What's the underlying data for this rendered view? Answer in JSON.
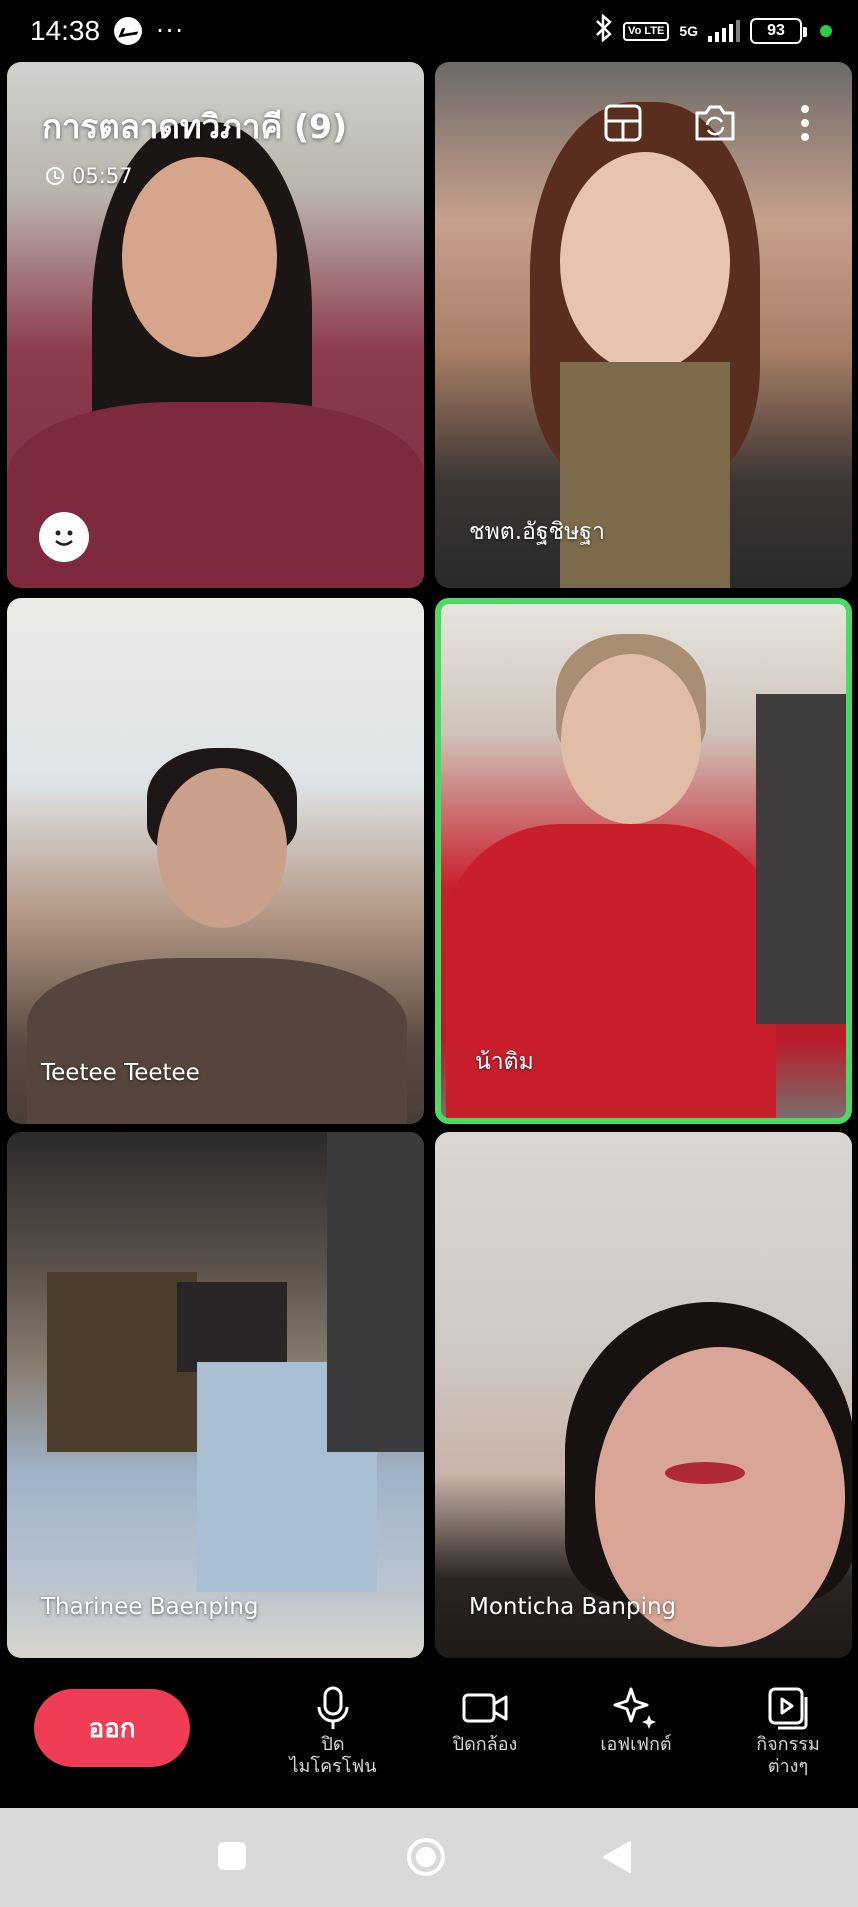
{
  "status_bar": {
    "time": "14:38",
    "more": "···",
    "volte": "Vo LTE",
    "network": "5G",
    "battery": "93"
  },
  "meeting": {
    "title": "การตลาดทวิภาคี (9)",
    "duration": "05:57"
  },
  "participants": [
    {
      "name": ""
    },
    {
      "name": "ชพต.อัฐชิษฐา"
    },
    {
      "name": "Teetee Teetee"
    },
    {
      "name": "น้าติม"
    },
    {
      "name": "Tharinee Baenping"
    },
    {
      "name": "Monticha Banping"
    }
  ],
  "controls": {
    "leave": "ออก",
    "mic": "ปิด\nไมโครโฟน",
    "camera": "ปิดกล้อง",
    "effects": "เอฟเฟกต์",
    "activities": "กิจกรรม\nต่างๆ"
  },
  "colors": {
    "leave_button": "#ef3d55",
    "active_speaker_border": "#4cd964",
    "nav_bar": "#d9d9d9"
  },
  "icons": [
    "messenger-icon",
    "bluetooth-icon",
    "signal-icon",
    "battery-icon",
    "clock-icon",
    "smile-icon",
    "layout-icon",
    "switch-camera-icon",
    "more-vertical-icon",
    "microphone-icon",
    "video-camera-icon",
    "sparkle-icon",
    "activities-icon",
    "recent-apps-icon",
    "home-icon",
    "back-icon"
  ]
}
